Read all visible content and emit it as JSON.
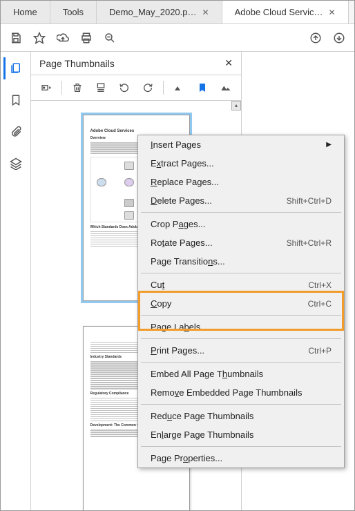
{
  "tabs": {
    "items": [
      {
        "label": "Home",
        "closable": false
      },
      {
        "label": "Tools",
        "closable": false
      },
      {
        "label": "Demo_May_2020.p…",
        "closable": true
      },
      {
        "label": "Adobe Cloud Servic…",
        "closable": true,
        "active": true
      }
    ]
  },
  "toolbar": {
    "icons": [
      "save",
      "star",
      "cloud-upload",
      "print",
      "zoom",
      "page-up",
      "page-down"
    ]
  },
  "sidebar": {
    "items": [
      {
        "name": "thumbnails",
        "active": true
      },
      {
        "name": "bookmarks"
      },
      {
        "name": "attachments"
      },
      {
        "name": "layers"
      }
    ]
  },
  "panel": {
    "title": "Page Thumbnails",
    "toolbar_icons": [
      "options",
      "delete",
      "insert-page",
      "rotate-ccw",
      "rotate-cw",
      "photo",
      "bookmark-fill",
      "photo-alt"
    ]
  },
  "thumbnails": [
    {
      "title": "Adobe Cloud Services",
      "section1": "Overview",
      "section2": "Which Standards Does Adobe F",
      "selected": true
    },
    {
      "title": "",
      "section1": "Industry Standards",
      "section2": "Regulatory Compliance",
      "section3": "Development: The Common Cont"
    }
  ],
  "context_menu": {
    "items": [
      {
        "label_pre": "",
        "u": "I",
        "label_post": "nsert Pages",
        "submenu": true
      },
      {
        "label_pre": "E",
        "u": "x",
        "label_post": "tract Pages..."
      },
      {
        "label_pre": "",
        "u": "R",
        "label_post": "eplace Pages..."
      },
      {
        "label_pre": "",
        "u": "D",
        "label_post": "elete Pages...",
        "shortcut": "Shift+Ctrl+D"
      },
      {
        "sep": true
      },
      {
        "label_pre": "Crop P",
        "u": "a",
        "label_post": "ges..."
      },
      {
        "label_pre": "Ro",
        "u": "t",
        "label_post": "ate Pages...",
        "shortcut": "Shift+Ctrl+R"
      },
      {
        "label_pre": "Page Transitio",
        "u": "n",
        "label_post": "s..."
      },
      {
        "sep": true
      },
      {
        "label_pre": "Cu",
        "u": "t",
        "label_post": "",
        "shortcut": "Ctrl+X"
      },
      {
        "label_pre": "",
        "u": "C",
        "label_post": "opy",
        "shortcut": "Ctrl+C"
      },
      {
        "sep": true
      },
      {
        "label_pre": "Page La",
        "u": "b",
        "label_post": "els..."
      },
      {
        "sep": true
      },
      {
        "label_pre": "",
        "u": "P",
        "label_post": "rint Pages...",
        "shortcut": "Ctrl+P"
      },
      {
        "sep": true
      },
      {
        "label_pre": "Embed All Page T",
        "u": "h",
        "label_post": "umbnails"
      },
      {
        "label_pre": "Remo",
        "u": "v",
        "label_post": "e Embedded Page Thumbnails"
      },
      {
        "sep": true
      },
      {
        "label_pre": "Red",
        "u": "u",
        "label_post": "ce Page Thumbnails"
      },
      {
        "label_pre": "En",
        "u": "l",
        "label_post": "arge Page Thumbnails"
      },
      {
        "sep": true
      },
      {
        "label_pre": "Page Pr",
        "u": "o",
        "label_post": "perties..."
      }
    ]
  }
}
